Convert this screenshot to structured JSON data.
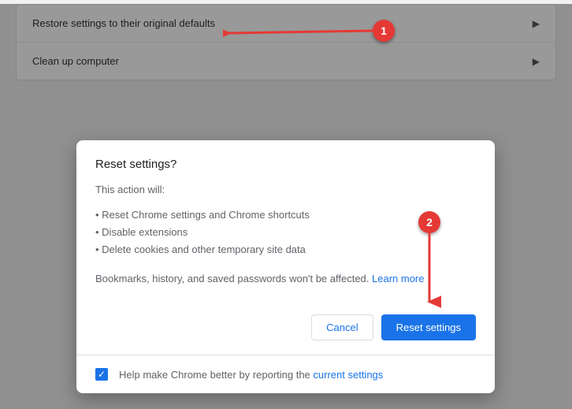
{
  "settings": {
    "rows": [
      {
        "label": "Restore settings to their original defaults"
      },
      {
        "label": "Clean up computer"
      }
    ]
  },
  "dialog": {
    "title": "Reset settings?",
    "intro": "This action will:",
    "bullets": [
      "Reset Chrome settings and Chrome shortcuts",
      "Disable extensions",
      "Delete cookies and other temporary site data"
    ],
    "note_prefix": "Bookmarks, history, and saved passwords won't be affected. ",
    "learn_more": "Learn more",
    "cancel_label": "Cancel",
    "reset_label": "Reset settings",
    "help_prefix": "Help make Chrome better by reporting the ",
    "help_link": "current settings"
  },
  "annotations": {
    "badge1": "1",
    "badge2": "2"
  }
}
